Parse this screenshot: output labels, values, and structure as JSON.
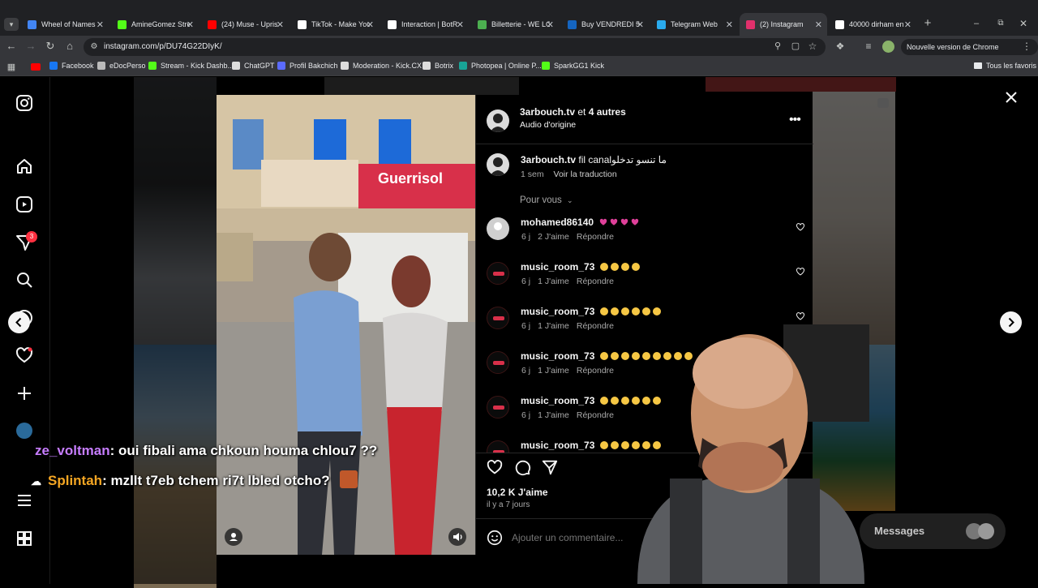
{
  "browser": {
    "tabs": [
      {
        "title": "Wheel of Names",
        "color": "#4285f4"
      },
      {
        "title": "AmineGomez Stre",
        "color": "#53fc18"
      },
      {
        "title": "(24) Muse - Upris",
        "color": "#ff0000"
      },
      {
        "title": "TikTok - Make You",
        "color": "#ffffff"
      },
      {
        "title": "Interaction | BotR",
        "color": "#ffffff"
      },
      {
        "title": "Billetterie - WE LC",
        "color": "#4caf50"
      },
      {
        "title": "Buy VENDREDI 5",
        "color": "#1565c0"
      },
      {
        "title": "Telegram Web",
        "color": "#2aabee"
      },
      {
        "title": "(2) Instagram",
        "color": "#e1306c"
      },
      {
        "title": "40000 dirham en",
        "color": "#ffffff"
      }
    ],
    "url": "instagram.com/p/DU74G22DIyK/",
    "update_label": "Nouvelle version de Chrome disponible",
    "bookmarks": [
      {
        "label": "Facebook",
        "color": "#1877f2"
      },
      {
        "label": "eDocPerso",
        "color": "#bbbbbb"
      },
      {
        "label": "Stream - Kick Dashb...",
        "color": "#53fc18"
      },
      {
        "label": "ChatGPT",
        "color": "#dddddd"
      },
      {
        "label": "Profil Bakchich",
        "color": "#5b6bff"
      },
      {
        "label": "Moderation - Kick.CX",
        "color": "#dddddd"
      },
      {
        "label": "Botrix",
        "color": "#dddddd"
      },
      {
        "label": "Photopea | Online P...",
        "color": "#18a497"
      },
      {
        "label": "SparkGG1 Kick",
        "color": "#53fc18"
      }
    ],
    "all_bookmarks": "Tous les favoris"
  },
  "sidebar": {
    "notification_badge": "3"
  },
  "post": {
    "author": "3arbouch.tv",
    "and": "et",
    "others": "4 autres",
    "audio": "Audio d'origine",
    "caption_user": "3arbouch.tv",
    "caption_text": "fil canalما تنسو تدخلو",
    "caption_time": "1 sem",
    "translate": "Voir la traduction",
    "sort_label": "Pour vous",
    "comments": [
      {
        "user": "mohamed86140",
        "emoji": "heart",
        "emoji_count": 4,
        "time": "6 j",
        "likes": "2 J'aime",
        "reply": "Répondre"
      },
      {
        "user": "music_room_73",
        "emoji": "laugh",
        "emoji_count": 4,
        "time": "6 j",
        "likes": "1 J'aime",
        "reply": "Répondre"
      },
      {
        "user": "music_room_73",
        "emoji": "laugh",
        "emoji_count": 6,
        "time": "6 j",
        "likes": "1 J'aime",
        "reply": "Répondre"
      },
      {
        "user": "music_room_73",
        "emoji": "laugh",
        "emoji_count": 9,
        "time": "6 j",
        "likes": "1 J'aime",
        "reply": "Répondre"
      },
      {
        "user": "music_room_73",
        "emoji": "laugh",
        "emoji_count": 6,
        "time": "6 j",
        "likes": "1 J'aime",
        "reply": "Répondre"
      },
      {
        "user": "music_room_73",
        "emoji": "laugh",
        "emoji_count": 6,
        "time": "",
        "likes": "",
        "reply": ""
      }
    ],
    "likes": "10,2 K J'aime",
    "posted": "il y a 7 jours",
    "comment_placeholder": "Ajouter un commentaire...",
    "video_sign": "Guerrisol"
  },
  "messages_label": "Messages",
  "chat": [
    {
      "user": "ze_voltman",
      "user_color": "#c77dff",
      "text": ": oui fibali ama chkoun houma chlou7 ??"
    },
    {
      "user": "Splintah",
      "user_color": "#f5a623",
      "text": ": mzllt t7eb tchem ri7t lbled otcho?"
    }
  ],
  "colors": {
    "like_red": "#ff3040",
    "accent": "#0095f6"
  }
}
